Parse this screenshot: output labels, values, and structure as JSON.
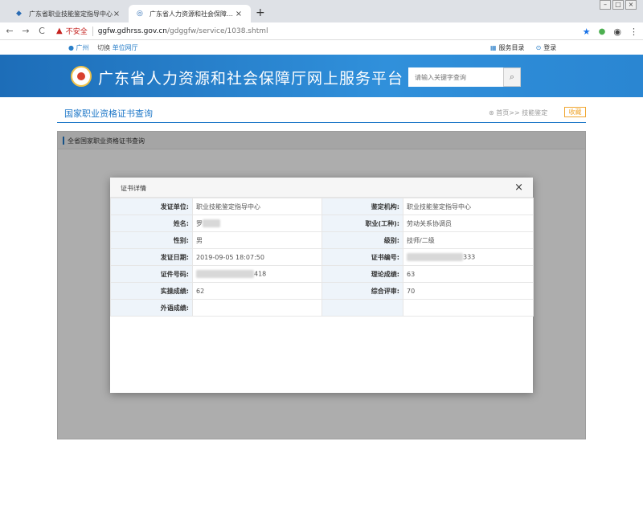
{
  "browser": {
    "tabs": [
      {
        "title": "广东省职业技能鉴定指导中心",
        "active": false
      },
      {
        "title": "广东省人力资源和社会保障厅网...",
        "active": true
      }
    ],
    "new_tab": "+",
    "security_label": "不安全",
    "url_host": "ggfw.gdhrss.gov.cn",
    "url_path": "/gdggfw/service/1038.shtml"
  },
  "topbar": {
    "city": "广州",
    "switch": "切换",
    "unit_hall": "单位网厅",
    "service_catalog": "服务目录",
    "login": "登录"
  },
  "banner": {
    "site_title": "广东省人力资源和社会保障厅网上服务平台",
    "search_placeholder": "请输入关键字查询"
  },
  "page": {
    "title": "国家职业资格证书查询",
    "breadcrumb": "首页>> 技能鉴定",
    "collect": "收藏",
    "panel_title": "全省国家职业资格证书查询"
  },
  "modal": {
    "title": "证书详情",
    "close": "×",
    "rows": [
      {
        "l1": "发证单位:",
        "v1": "职业技能鉴定指导中心",
        "l2": "鉴定机构:",
        "v2": "职业技能鉴定指导中心"
      },
      {
        "l1": "姓名:",
        "v1": "罗",
        "l2": "职业(工种):",
        "v2": "劳动关系协调员"
      },
      {
        "l1": "性别:",
        "v1": "男",
        "l2": "级别:",
        "v2": "技师/二级"
      },
      {
        "l1": "发证日期:",
        "v1": "2019-09-05 18:07:50",
        "l2": "证书编号:",
        "v2": "333"
      },
      {
        "l1": "证件号码:",
        "v1": "418",
        "l2": "理论成绩:",
        "v2": "63"
      },
      {
        "l1": "实操成绩:",
        "v1": "62",
        "l2": "综合评审:",
        "v2": "70"
      },
      {
        "l1": "外语成绩:",
        "v1": "",
        "l2": "",
        "v2": ""
      }
    ]
  },
  "colors": {
    "brand_blue": "#1f78c8",
    "banner_blue": "#2a86d2",
    "collect_orange": "#f0a630"
  }
}
